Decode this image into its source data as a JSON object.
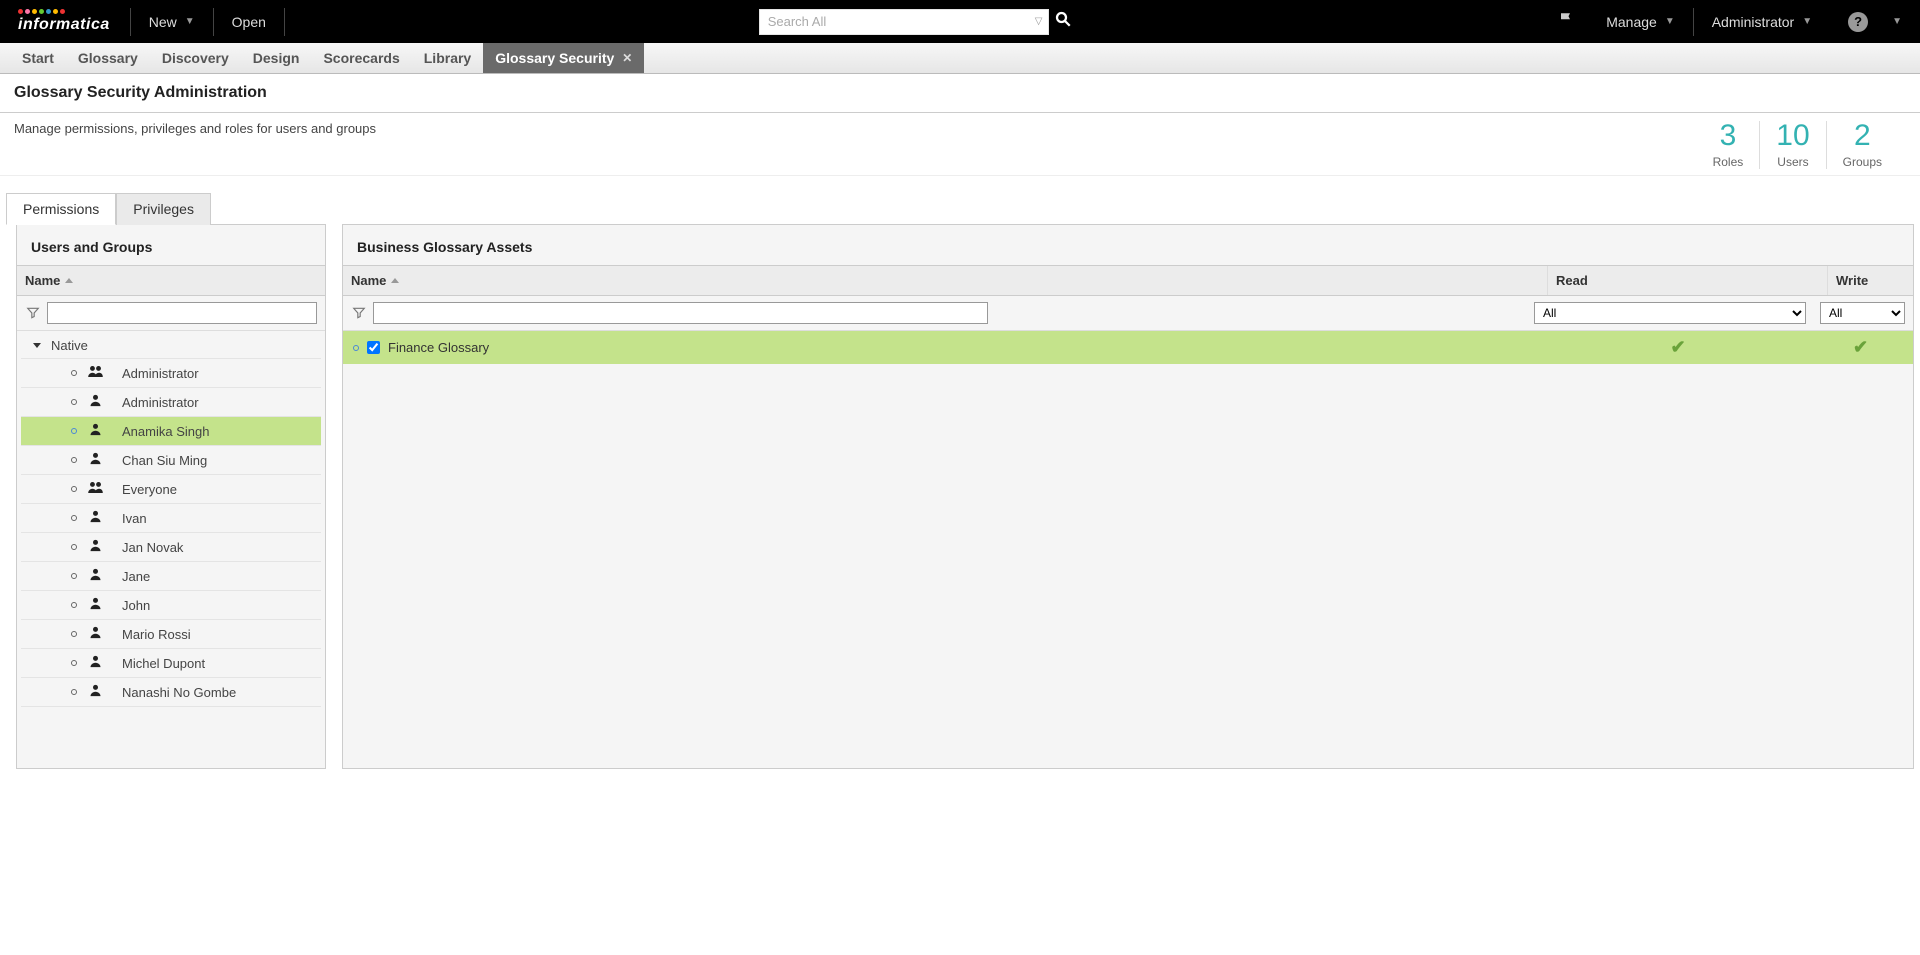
{
  "top": {
    "new": "New",
    "open": "Open",
    "search_placeholder": "Search All",
    "manage": "Manage",
    "user": "Administrator"
  },
  "nav": {
    "tabs": [
      "Start",
      "Glossary",
      "Discovery",
      "Design",
      "Scorecards",
      "Library",
      "Glossary Security"
    ],
    "active_index": 6
  },
  "header": {
    "title": "Glossary Security Administration",
    "desc": "Manage permissions, privileges and roles for users and groups"
  },
  "counts": [
    {
      "num": "3",
      "label": "Roles"
    },
    {
      "num": "10",
      "label": "Users"
    },
    {
      "num": "2",
      "label": "Groups"
    }
  ],
  "subtabs": [
    "Permissions",
    "Privileges"
  ],
  "subtab_active": 0,
  "left": {
    "title": "Users and Groups",
    "col": "Name",
    "group": "Native",
    "users": [
      {
        "name": "Administrator",
        "type": "group"
      },
      {
        "name": "Administrator",
        "type": "user"
      },
      {
        "name": "Anamika Singh",
        "type": "user",
        "selected": true
      },
      {
        "name": "Chan Siu Ming",
        "type": "user"
      },
      {
        "name": "Everyone",
        "type": "group"
      },
      {
        "name": "Ivan",
        "type": "user"
      },
      {
        "name": "Jan Novak",
        "type": "user"
      },
      {
        "name": "Jane",
        "type": "user"
      },
      {
        "name": "John",
        "type": "user"
      },
      {
        "name": "Mario Rossi",
        "type": "user"
      },
      {
        "name": "Michel Dupont",
        "type": "user"
      },
      {
        "name": "Nanashi No Gombe",
        "type": "user"
      }
    ]
  },
  "right": {
    "title": "Business Glossary Assets",
    "cols": {
      "name": "Name",
      "read": "Read",
      "write": "Write"
    },
    "filter_all": "All",
    "rows": [
      {
        "name": "Finance Glossary",
        "checked": true,
        "read": true,
        "write": true
      }
    ]
  }
}
